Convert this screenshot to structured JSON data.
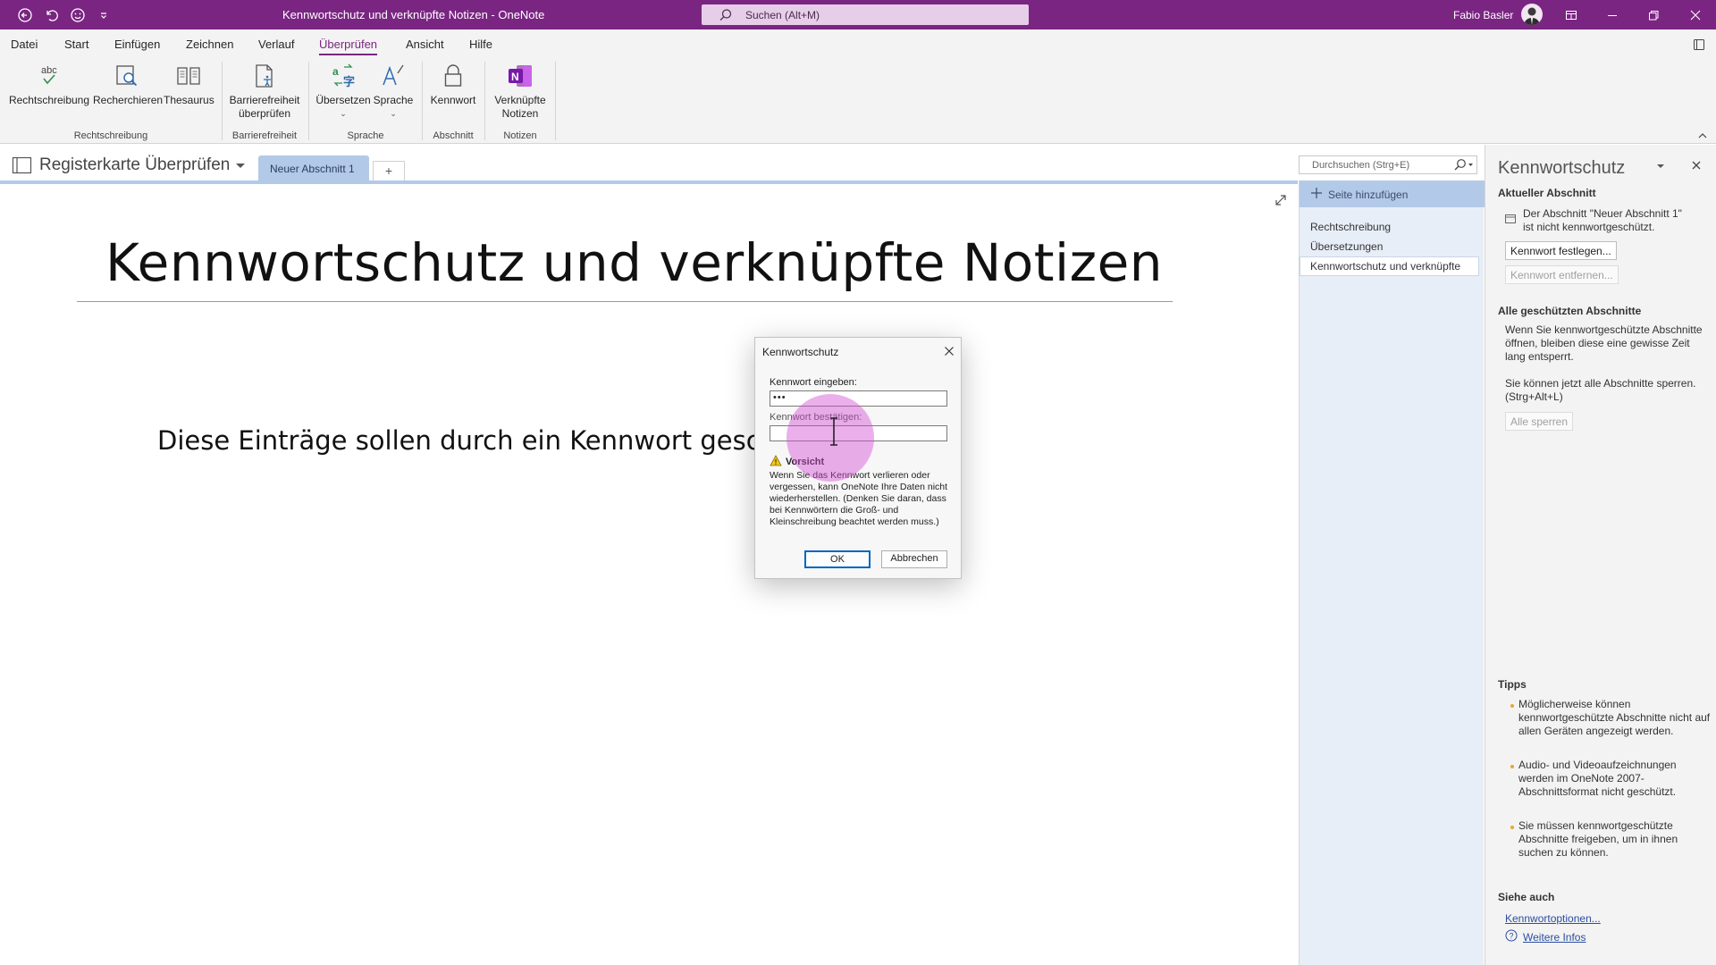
{
  "titlebar": {
    "title": "Kennwortschutz und verknüpfte Notizen  -  OneNote",
    "search_placeholder": "Suchen (Alt+M)",
    "user": "Fabio Basler"
  },
  "ribbon_tabs": [
    "Datei",
    "Start",
    "Einfügen",
    "Zeichnen",
    "Verlauf",
    "Überprüfen",
    "Ansicht",
    "Hilfe"
  ],
  "ribbon_active_tab": "Überprüfen",
  "ribbon": {
    "spelling": "Rechtschreibung",
    "research": "Recherchieren",
    "thesaurus": "Thesaurus",
    "accessibility_line1": "Barrierefreiheit",
    "accessibility_line2": "überprüfen",
    "translate": "Übersetzen",
    "language": "Sprache",
    "password": "Kennwort",
    "linked_line1": "Verknüpfte",
    "linked_line2": "Notizen",
    "groups": {
      "spelling": "Rechtschreibung",
      "accessibility": "Barrierefreiheit",
      "language": "Sprache",
      "section": "Abschnitt",
      "notes": "Notizen"
    },
    "icon_spelling_text": "abc"
  },
  "notebook": {
    "name": "Registerkarte Überprüfen",
    "section_tab": "Neuer Abschnitt 1",
    "add_section": "+"
  },
  "page_search_placeholder": "Durchsuchen (Strg+E)",
  "pagelist": {
    "add_page": "Seite hinzufügen",
    "pages": [
      "Rechtschreibung",
      "Übersetzungen",
      "Kennwortschutz und verknüpfte"
    ]
  },
  "canvas": {
    "title": "Kennwortschutz und verknüpfte Notizen",
    "body": "Diese Einträge sollen durch ein Kennwort gesc"
  },
  "taskpane": {
    "title": "Kennwortschutz",
    "current_section_heading": "Aktueller Abschnitt",
    "current_section_text_1": "Der Abschnitt \"Neuer Abschnitt 1\"",
    "current_section_text_2": "ist nicht kennwortgeschützt.",
    "set_password": "Kennwort festlegen...",
    "remove_password": "Kennwort entfernen...",
    "all_protected_heading": "Alle geschützten Abschnitte",
    "all_protected_text": "Wenn Sie kennwortgeschützte Abschnitte öffnen, bleiben diese eine gewisse Zeit lang entsperrt.",
    "lock_text": "Sie können jetzt alle Abschnitte sperren. (Strg+Alt+L)",
    "lock_all": "Alle sperren",
    "tips_heading": "Tipps",
    "tips": [
      "Möglicherweise können kennwortgeschützte Abschnitte nicht auf allen Geräten angezeigt werden.",
      "Audio- und Videoaufzeichnungen werden im OneNote 2007-Abschnittsformat nicht geschützt.",
      "Sie müssen kennwortgeschützte Abschnitte freigeben, um in ihnen suchen zu können."
    ],
    "see_also_heading": "Siehe auch",
    "link_options": "Kennwortoptionen...",
    "link_more": "Weitere Infos"
  },
  "dialog": {
    "title": "Kennwortschutz",
    "enter_label": "Kennwort eingeben:",
    "enter_value": "•••",
    "confirm_label": "Kennwort bestätigen:",
    "confirm_value": "",
    "warning_title": "Vorsicht",
    "warning_text": "Wenn Sie das Kennwort verlieren oder vergessen, kann OneNote Ihre Daten nicht wiederherstellen. (Denken Sie daran, dass bei Kennwörtern die Groß- und Kleinschreibung beachtet werden muss.)",
    "ok": "OK",
    "cancel": "Abbrechen"
  },
  "colors": {
    "onenote_purple": "#7a2582",
    "section_blue": "#b3c9e8"
  }
}
